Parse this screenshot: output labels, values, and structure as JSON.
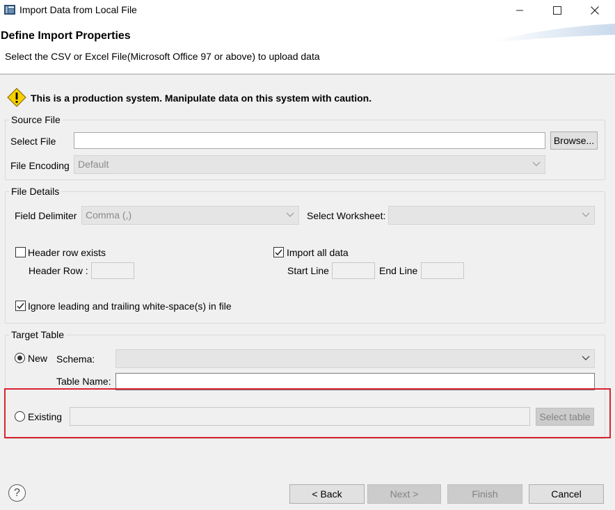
{
  "window": {
    "title": "Import Data from Local File",
    "minimize_icon": "minimize-icon",
    "maximize_icon": "maximize-icon",
    "close_icon": "close-icon"
  },
  "header": {
    "title": "Define Import Properties",
    "description": "Select the CSV or Excel File(Microsoft Office 97 or above) to upload data"
  },
  "warning": {
    "text": "This is a production system. Manipulate data on this system with caution."
  },
  "source_file": {
    "legend": "Source File",
    "select_file_label": "Select File",
    "select_file_value": "",
    "browse_label": "Browse...",
    "encoding_label": "File Encoding",
    "encoding_value": "Default"
  },
  "file_details": {
    "legend": "File Details",
    "delimiter_label": "Field Delimiter",
    "delimiter_value": "Comma (,)",
    "worksheet_label": "Select Worksheet:",
    "worksheet_value": "",
    "header_row_exists_label": "Header row exists",
    "header_row_exists_checked": false,
    "header_row_label": "Header Row :",
    "header_row_value": "",
    "import_all_label": "Import all data",
    "import_all_checked": true,
    "start_line_label": "Start Line",
    "start_line_value": "",
    "end_line_label": "End Line",
    "end_line_value": "",
    "ignore_whitespace_label": "Ignore leading and trailing white-space(s) in file",
    "ignore_whitespace_checked": true
  },
  "target_table": {
    "legend": "Target Table",
    "new_label": "New",
    "new_selected": true,
    "schema_label": "Schema:",
    "schema_value": "",
    "table_name_label": "Table Name:",
    "table_name_value": "",
    "existing_label": "Existing",
    "existing_selected": false,
    "existing_value": "",
    "select_table_label": "Select table"
  },
  "footer": {
    "back_label": "< Back",
    "next_label": "Next >",
    "finish_label": "Finish",
    "cancel_label": "Cancel",
    "help_icon_glyph": "?"
  },
  "colors": {
    "highlight_border": "#d9232e",
    "warning_yellow": "#f7d000"
  }
}
